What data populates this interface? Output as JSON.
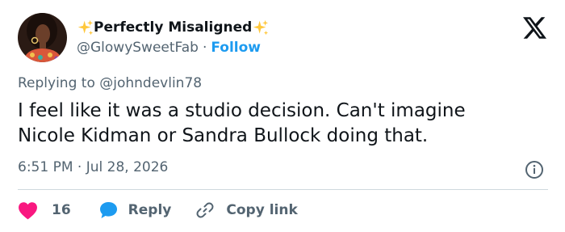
{
  "author": {
    "display_name": "Perfectly Misaligned",
    "handle": "@GlowySweetFab",
    "separator": "·",
    "follow_label": "Follow",
    "decoration_icon": "sparkles-icon"
  },
  "tweet": {
    "replying_to": "Replying to @johndevlin78",
    "text_line1": "I feel like it was a studio decision. Can't imagine",
    "text_line2": "Nicole Kidman or Sandra Bullock doing that.",
    "timestamp": "6:51 PM · Jul 28, 2026"
  },
  "actions": {
    "like_count": "16",
    "reply_label": "Reply",
    "copy_link_label": "Copy link"
  },
  "colors": {
    "accent": "#1d9bf0",
    "like": "#f91880",
    "secondary_text": "#536471",
    "primary_text": "#0f1419"
  }
}
